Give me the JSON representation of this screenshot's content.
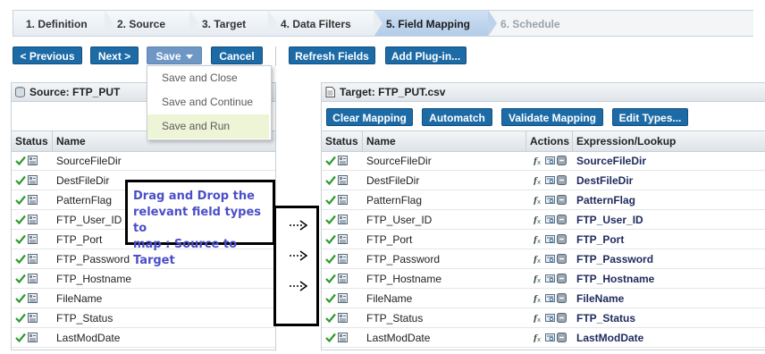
{
  "wizard": {
    "steps": [
      {
        "label": "1. Definition"
      },
      {
        "label": "2. Source"
      },
      {
        "label": "3. Target"
      },
      {
        "label": "4. Data Filters"
      },
      {
        "label": "5. Field Mapping"
      },
      {
        "label": "6. Schedule"
      }
    ],
    "active": "5. Field Mapping"
  },
  "toolbar": {
    "previous": "< Previous",
    "next": "Next >",
    "save": "Save",
    "cancel": "Cancel",
    "refresh": "Refresh Fields",
    "add_plugin": "Add Plug-in..."
  },
  "save_menu": {
    "items": [
      "Save and Close",
      "Save and Continue",
      "Save and Run"
    ],
    "highlighted": "Save and Run"
  },
  "source": {
    "title": "Source: FTP_PUT",
    "columns": [
      "Status",
      "Name"
    ],
    "rows": [
      "SourceFileDir",
      "DestFileDir",
      "PatternFlag",
      "FTP_User_ID",
      "FTP_Port",
      "FTP_Password",
      "FTP_Hostname",
      "FileName",
      "FTP_Status",
      "LastModDate"
    ]
  },
  "target": {
    "title": "Target: FTP_PUT.csv",
    "buttons": {
      "clear": "Clear Mapping",
      "automatch": "Automatch",
      "validate": "Validate Mapping",
      "edit_types": "Edit Types..."
    },
    "columns": [
      "Status",
      "Name",
      "Actions",
      "Expression/Lookup"
    ],
    "rows": [
      {
        "name": "SourceFileDir",
        "expr": "SourceFileDir"
      },
      {
        "name": "DestFileDir",
        "expr": "DestFileDir"
      },
      {
        "name": "PatternFlag",
        "expr": "PatternFlag"
      },
      {
        "name": "FTP_User_ID",
        "expr": "FTP_User_ID"
      },
      {
        "name": "FTP_Port",
        "expr": "FTP_Port"
      },
      {
        "name": "FTP_Password",
        "expr": "FTP_Password"
      },
      {
        "name": "FTP_Hostname",
        "expr": "FTP_Hostname"
      },
      {
        "name": "FileName",
        "expr": "FileName"
      },
      {
        "name": "FTP_Status",
        "expr": "FTP_Status"
      },
      {
        "name": "LastModDate",
        "expr": "LastModDate"
      }
    ]
  },
  "annotation": {
    "line1": "Drag and Drop the",
    "line2": "relevant field types to",
    "line3": "map : Source to Target"
  },
  "colors": {
    "button": "#1d6ba6",
    "save_button": "#6e97c5",
    "active_step": "#b3cce8",
    "expression_text": "#1f2a5c",
    "annotation_text": "#4a4ec8",
    "menu_highlight": "#eef4d6"
  }
}
